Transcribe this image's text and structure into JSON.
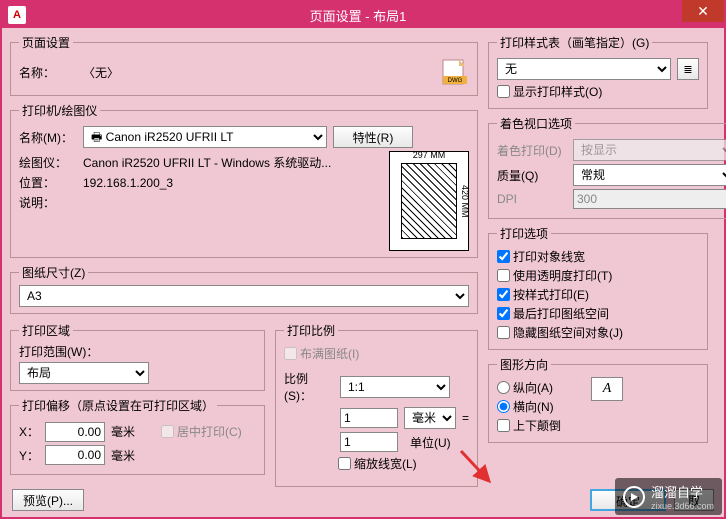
{
  "window": {
    "title": "页面设置 - 布局1"
  },
  "page_setup": {
    "legend": "页面设置",
    "name_label": "名称：",
    "name_value": "〈无〉"
  },
  "printer": {
    "legend": "打印机/绘图仪",
    "name_label": "名称(M)：",
    "name_value": "Canon iR2520 UFRII LT",
    "props_btn": "特性(R)",
    "plotter_label": "绘图仪：",
    "plotter_value": "Canon iR2520 UFRII LT - Windows 系统驱动...",
    "location_label": "位置：",
    "location_value": "192.168.1.200_3",
    "desc_label": "说明：",
    "preview_w": "297 MM",
    "preview_h": "420 MM"
  },
  "paper": {
    "legend": "图纸尺寸(Z)",
    "value": "A3"
  },
  "area": {
    "legend": "打印区域",
    "range_label": "打印范围(W)：",
    "range_value": "布局"
  },
  "offset": {
    "legend": "打印偏移（原点设置在可打印区域）",
    "x_label": "X：",
    "x_value": "0.00",
    "y_label": "Y：",
    "y_value": "0.00",
    "unit": "毫米",
    "center_label": "居中打印(C)"
  },
  "scale": {
    "legend": "打印比例",
    "fit_label": "布满图纸(I)",
    "ratio_label": "比例(S)：",
    "ratio_value": "1:1",
    "mm_value": "1",
    "mm_unit": "毫米",
    "unit_value": "1",
    "unit_unit": "单位(U)",
    "scale_lw_label": "缩放线宽(L)"
  },
  "style": {
    "legend": "打印样式表（画笔指定）(G)",
    "value": "无",
    "show_label": "显示打印样式(O)"
  },
  "viewport": {
    "legend": "着色视口选项",
    "shade_label": "着色打印(D)",
    "shade_value": "按显示",
    "quality_label": "质量(Q)",
    "quality_value": "常规",
    "dpi_label": "DPI",
    "dpi_value": "300"
  },
  "options": {
    "legend": "打印选项",
    "lw": "打印对象线宽",
    "trans": "使用透明度打印(T)",
    "style": "按样式打印(E)",
    "paper": "最后打印图纸空间",
    "hide": "隐藏图纸空间对象(J)"
  },
  "orient": {
    "legend": "图形方向",
    "portrait": "纵向(A)",
    "landscape": "横向(N)",
    "upside": "上下颠倒"
  },
  "footer": {
    "preview": "预览(P)...",
    "ok": "确定",
    "cancel": "取"
  },
  "watermark": {
    "brand": "溜溜自学",
    "url": "zixue.3d66.com"
  }
}
